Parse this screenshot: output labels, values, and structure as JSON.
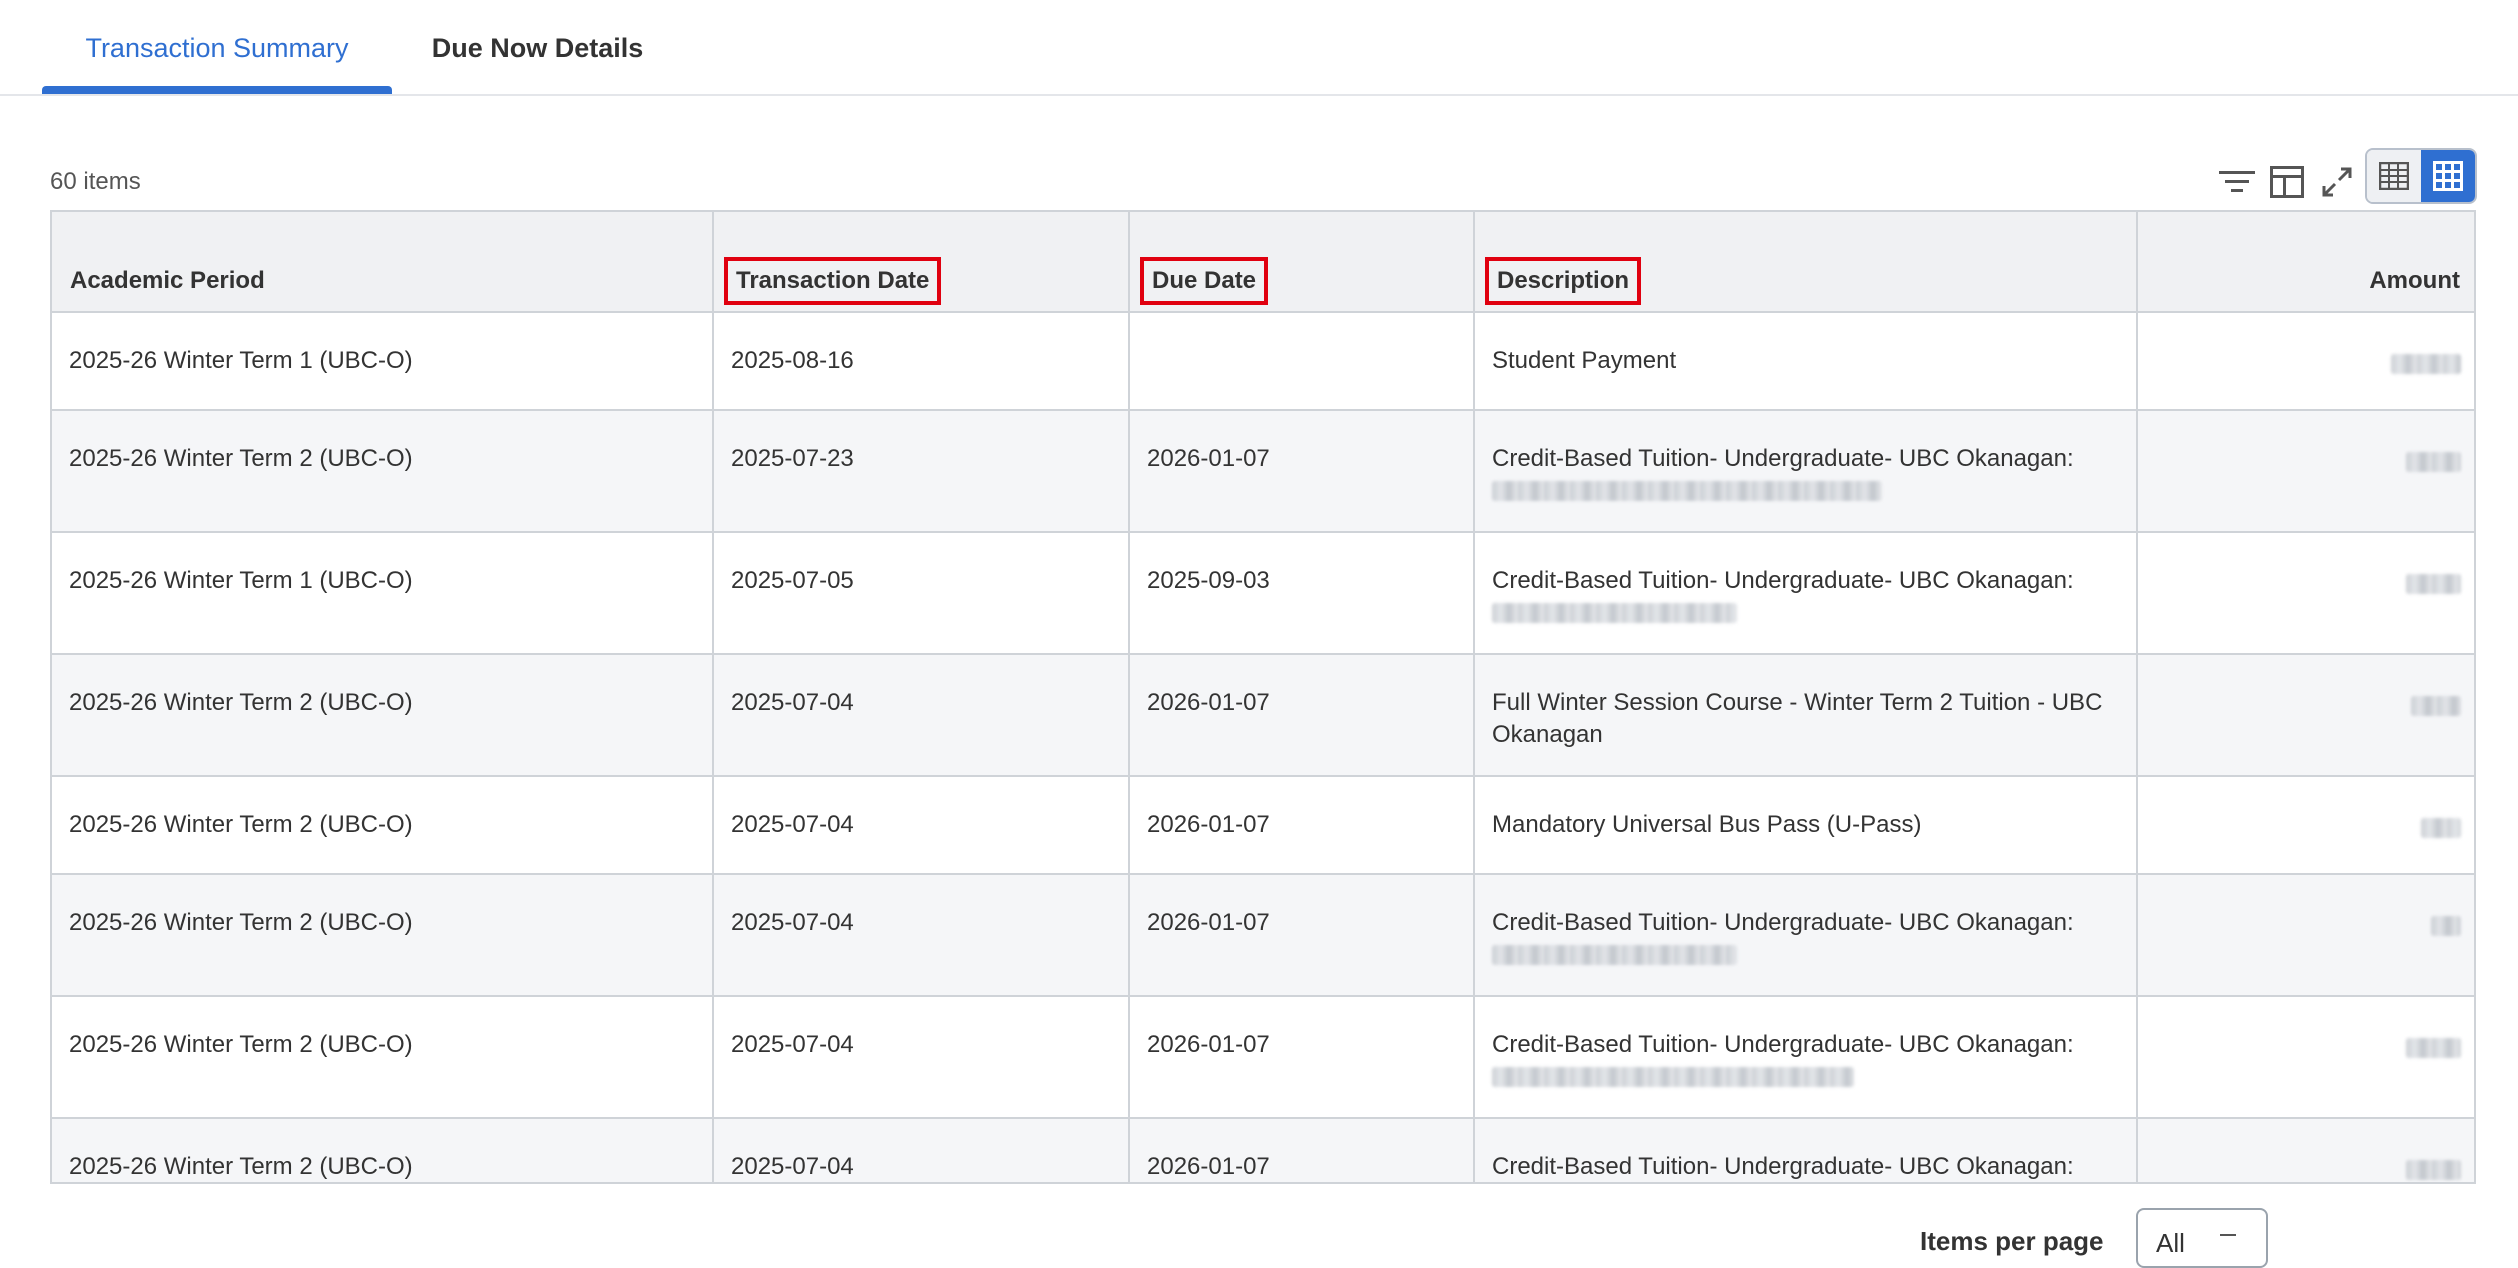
{
  "tabs": {
    "summary": "Transaction Summary",
    "due_now": "Due Now Details"
  },
  "items_count": "60 items",
  "toolbar": {
    "icons": [
      "filter-icon",
      "column-layout-icon",
      "expand-icon",
      "table-view-icon",
      "grid-view-icon"
    ]
  },
  "table": {
    "columns": [
      "Academic Period",
      "Transaction Date",
      "Due Date",
      "Description",
      "Amount"
    ],
    "rows": [
      {
        "period": "2025-26 Winter Term 1 (UBC-O)",
        "tdate": "2025-08-16",
        "ddate": "",
        "desc": "Student Payment",
        "desc2_redacted": false,
        "amount_redacted": true
      },
      {
        "period": "2025-26 Winter Term 2 (UBC-O)",
        "tdate": "2025-07-23",
        "ddate": "2026-01-07",
        "desc": "Credit-Based Tuition- Undergraduate- UBC Okanagan:",
        "desc2_redacted": true,
        "amount_redacted": true
      },
      {
        "period": "2025-26 Winter Term 1 (UBC-O)",
        "tdate": "2025-07-05",
        "ddate": "2025-09-03",
        "desc": "Credit-Based Tuition- Undergraduate- UBC Okanagan:",
        "desc2_redacted": true,
        "amount_redacted": true
      },
      {
        "period": "2025-26 Winter Term 2 (UBC-O)",
        "tdate": "2025-07-04",
        "ddate": "2026-01-07",
        "desc": "Full Winter Session Course - Winter Term 2 Tuition - UBC Okanagan",
        "desc2_redacted": false,
        "amount_redacted": true
      },
      {
        "period": "2025-26 Winter Term 2 (UBC-O)",
        "tdate": "2025-07-04",
        "ddate": "2026-01-07",
        "desc": "Mandatory Universal Bus Pass (U-Pass)",
        "desc2_redacted": false,
        "amount_redacted": true
      },
      {
        "period": "2025-26 Winter Term 2 (UBC-O)",
        "tdate": "2025-07-04",
        "ddate": "2026-01-07",
        "desc": "Credit-Based Tuition- Undergraduate- UBC Okanagan:",
        "desc2_redacted": true,
        "amount_redacted": true
      },
      {
        "period": "2025-26 Winter Term 2 (UBC-O)",
        "tdate": "2025-07-04",
        "ddate": "2026-01-07",
        "desc": "Credit-Based Tuition- Undergraduate- UBC Okanagan:",
        "desc2_redacted": true,
        "amount_redacted": true
      },
      {
        "period": "2025-26 Winter Term 2 (UBC-O)",
        "tdate": "2025-07-04",
        "ddate": "2026-01-07",
        "desc": "Credit-Based Tuition- Undergraduate- UBC Okanagan:",
        "desc2_redacted": true,
        "amount_redacted": true
      }
    ]
  },
  "pagination": {
    "label": "Items per page",
    "value": "All"
  },
  "colors": {
    "accent": "#2f6fd1",
    "highlight": "#e0000f"
  }
}
